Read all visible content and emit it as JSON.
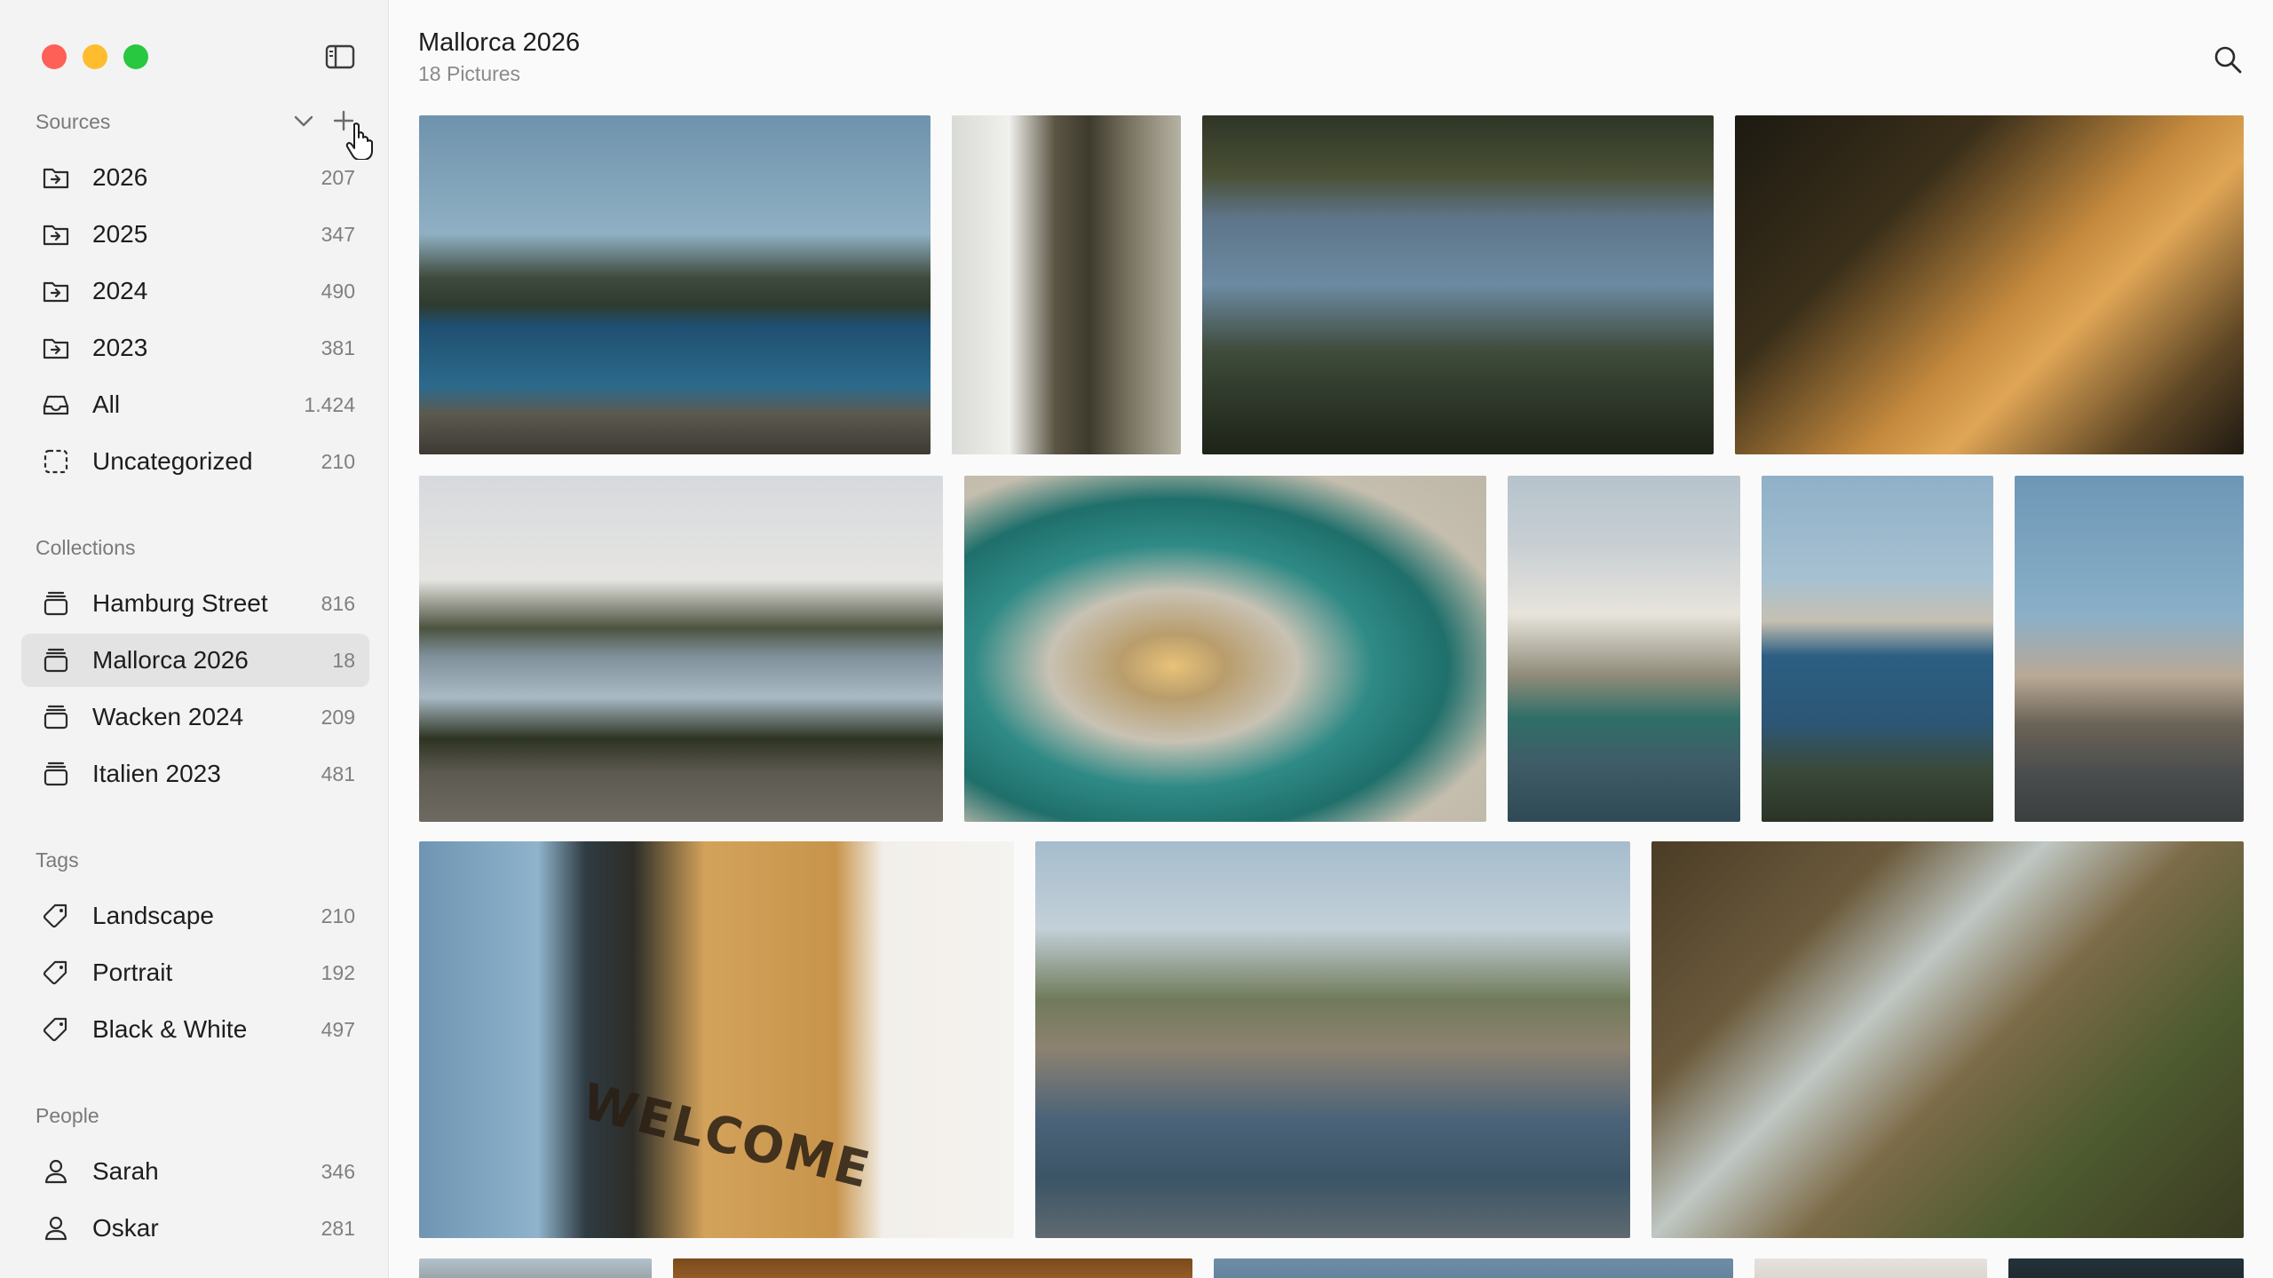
{
  "window": {
    "controls": [
      "close",
      "minimize",
      "zoom"
    ]
  },
  "sidebar": {
    "sources": {
      "heading": "Sources",
      "items": [
        {
          "label": "2026",
          "count": "207",
          "icon": "folder-import-icon"
        },
        {
          "label": "2025",
          "count": "347",
          "icon": "folder-import-icon"
        },
        {
          "label": "2024",
          "count": "490",
          "icon": "folder-import-icon"
        },
        {
          "label": "2023",
          "count": "381",
          "icon": "folder-import-icon"
        },
        {
          "label": "All",
          "count": "1.424",
          "icon": "tray-icon"
        },
        {
          "label": "Uncategorized",
          "count": "210",
          "icon": "dashed-square-icon"
        }
      ]
    },
    "collections": {
      "heading": "Collections",
      "items": [
        {
          "label": "Hamburg Street",
          "count": "816",
          "icon": "stack-icon"
        },
        {
          "label": "Mallorca 2026",
          "count": "18",
          "icon": "stack-icon",
          "selected": true
        },
        {
          "label": "Wacken 2024",
          "count": "209",
          "icon": "stack-icon"
        },
        {
          "label": "Italien 2023",
          "count": "481",
          "icon": "stack-icon"
        }
      ]
    },
    "tags": {
      "heading": "Tags",
      "items": [
        {
          "label": "Landscape",
          "count": "210",
          "icon": "tag-icon"
        },
        {
          "label": "Portrait",
          "count": "192",
          "icon": "tag-icon"
        },
        {
          "label": "Black & White",
          "count": "497",
          "icon": "tag-icon"
        }
      ]
    },
    "people": {
      "heading": "People",
      "items": [
        {
          "label": "Sarah",
          "count": "346",
          "icon": "person-icon"
        },
        {
          "label": "Oskar",
          "count": "281",
          "icon": "person-icon"
        }
      ]
    }
  },
  "main": {
    "title": "Mallorca 2026",
    "subtitle": "18 Pictures",
    "photos": [
      {
        "subject": "coastline at dusk"
      },
      {
        "subject": "white house with tree"
      },
      {
        "subject": "pine trees over bay"
      },
      {
        "subject": "sunlit building facade"
      },
      {
        "subject": "cove with rocky shore"
      },
      {
        "subject": "green fishing nets with crate"
      },
      {
        "subject": "white houses at harbor"
      },
      {
        "subject": "bay with palm"
      },
      {
        "subject": "street lamp at dusk"
      },
      {
        "subject": "child at door on welcome mat",
        "mat_text": "WELCOME"
      },
      {
        "subject": "marina with sailboats"
      },
      {
        "subject": "old tree in forest"
      },
      {
        "subject": "partial photo"
      },
      {
        "subject": "partial photo"
      },
      {
        "subject": "partial photo"
      },
      {
        "subject": "partial photo"
      },
      {
        "subject": "partial photo"
      }
    ]
  },
  "colors": {
    "close": "#fe5f57",
    "minimize": "#febc2e",
    "zoom": "#28c840",
    "sidebar_bg": "#f3f3f3",
    "selected_bg": "#e3e3e3"
  }
}
